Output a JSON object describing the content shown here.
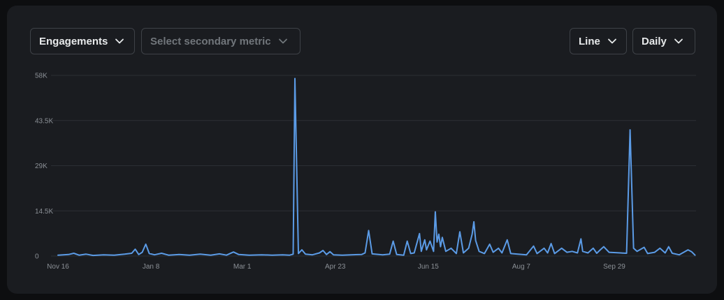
{
  "controls": {
    "primary_metric": "Engagements",
    "secondary_metric_placeholder": "Select secondary metric",
    "chart_type": "Line",
    "interval": "Daily"
  },
  "colors": {
    "line": "#5b9be6",
    "grid": "#2c2f34",
    "background": "#1a1c20"
  },
  "chart_data": {
    "type": "line",
    "title": "",
    "xlabel": "",
    "ylabel": "",
    "ylim": [
      0,
      58000
    ],
    "y_ticks": [
      {
        "value": 0,
        "label": "0"
      },
      {
        "value": 14500,
        "label": "14.5K"
      },
      {
        "value": 29000,
        "label": "29K"
      },
      {
        "value": 43500,
        "label": "43.5K"
      },
      {
        "value": 58000,
        "label": "58K"
      }
    ],
    "x_ticks": [
      {
        "date": "2022-11-16",
        "label": "Nov 16"
      },
      {
        "date": "2023-01-08",
        "label": "Jan 8"
      },
      {
        "date": "2023-03-01",
        "label": "Mar 1"
      },
      {
        "date": "2023-04-23",
        "label": "Apr 23"
      },
      {
        "date": "2023-06-15",
        "label": "Jun 15"
      },
      {
        "date": "2023-08-07",
        "label": "Aug 7"
      },
      {
        "date": "2023-09-29",
        "label": "Sep 29"
      }
    ],
    "grid": true,
    "legend": "none",
    "series": [
      {
        "points": [
          [
            "2022-11-16",
            300
          ],
          [
            "2022-11-22",
            500
          ],
          [
            "2022-11-25",
            900
          ],
          [
            "2022-11-28",
            300
          ],
          [
            "2022-12-02",
            600
          ],
          [
            "2022-12-06",
            200
          ],
          [
            "2022-12-12",
            400
          ],
          [
            "2022-12-18",
            300
          ],
          [
            "2022-12-24",
            600
          ],
          [
            "2022-12-28",
            900
          ],
          [
            "2022-12-30",
            2200
          ],
          [
            "2023-01-01",
            500
          ],
          [
            "2023-01-03",
            1200
          ],
          [
            "2023-01-05",
            3800
          ],
          [
            "2023-01-07",
            800
          ],
          [
            "2023-01-10",
            400
          ],
          [
            "2023-01-14",
            900
          ],
          [
            "2023-01-18",
            300
          ],
          [
            "2023-01-24",
            500
          ],
          [
            "2023-01-30",
            300
          ],
          [
            "2023-02-05",
            600
          ],
          [
            "2023-02-11",
            300
          ],
          [
            "2023-02-16",
            700
          ],
          [
            "2023-02-20",
            300
          ],
          [
            "2023-02-24",
            1300
          ],
          [
            "2023-02-27",
            500
          ],
          [
            "2023-03-05",
            300
          ],
          [
            "2023-03-12",
            400
          ],
          [
            "2023-03-18",
            300
          ],
          [
            "2023-03-24",
            400
          ],
          [
            "2023-03-28",
            300
          ],
          [
            "2023-03-30",
            600
          ],
          [
            "2023-03-31",
            57000
          ],
          [
            "2023-04-02",
            800
          ],
          [
            "2023-04-04",
            2000
          ],
          [
            "2023-04-06",
            600
          ],
          [
            "2023-04-10",
            400
          ],
          [
            "2023-04-14",
            1000
          ],
          [
            "2023-04-16",
            1800
          ],
          [
            "2023-04-18",
            500
          ],
          [
            "2023-04-20",
            1400
          ],
          [
            "2023-04-22",
            400
          ],
          [
            "2023-04-27",
            300
          ],
          [
            "2023-05-02",
            400
          ],
          [
            "2023-05-08",
            500
          ],
          [
            "2023-05-10",
            1000
          ],
          [
            "2023-05-12",
            8200
          ],
          [
            "2023-05-14",
            700
          ],
          [
            "2023-05-20",
            400
          ],
          [
            "2023-05-24",
            600
          ],
          [
            "2023-05-26",
            4800
          ],
          [
            "2023-05-28",
            500
          ],
          [
            "2023-06-01",
            300
          ],
          [
            "2023-06-03",
            4800
          ],
          [
            "2023-06-05",
            800
          ],
          [
            "2023-06-07",
            1000
          ],
          [
            "2023-06-10",
            7200
          ],
          [
            "2023-06-11",
            1500
          ],
          [
            "2023-06-13",
            5200
          ],
          [
            "2023-06-14",
            2000
          ],
          [
            "2023-06-16",
            4800
          ],
          [
            "2023-06-18",
            1500
          ],
          [
            "2023-06-19",
            14200
          ],
          [
            "2023-06-20",
            4500
          ],
          [
            "2023-06-21",
            7000
          ],
          [
            "2023-06-22",
            3000
          ],
          [
            "2023-06-23",
            6000
          ],
          [
            "2023-06-25",
            1500
          ],
          [
            "2023-06-28",
            2500
          ],
          [
            "2023-07-01",
            800
          ],
          [
            "2023-07-03",
            7800
          ],
          [
            "2023-07-05",
            1000
          ],
          [
            "2023-07-08",
            2500
          ],
          [
            "2023-07-10",
            7000
          ],
          [
            "2023-07-11",
            11000
          ],
          [
            "2023-07-12",
            5000
          ],
          [
            "2023-07-14",
            1500
          ],
          [
            "2023-07-17",
            800
          ],
          [
            "2023-07-20",
            3800
          ],
          [
            "2023-07-22",
            1200
          ],
          [
            "2023-07-25",
            2500
          ],
          [
            "2023-07-27",
            1000
          ],
          [
            "2023-07-30",
            5200
          ],
          [
            "2023-08-01",
            800
          ],
          [
            "2023-08-05",
            600
          ],
          [
            "2023-08-10",
            400
          ],
          [
            "2023-08-14",
            3200
          ],
          [
            "2023-08-16",
            800
          ],
          [
            "2023-08-20",
            2500
          ],
          [
            "2023-08-22",
            1000
          ],
          [
            "2023-08-24",
            4000
          ],
          [
            "2023-08-26",
            800
          ],
          [
            "2023-08-30",
            2500
          ],
          [
            "2023-09-02",
            1200
          ],
          [
            "2023-09-05",
            1500
          ],
          [
            "2023-09-08",
            1000
          ],
          [
            "2023-09-10",
            5500
          ],
          [
            "2023-09-11",
            1500
          ],
          [
            "2023-09-14",
            1000
          ],
          [
            "2023-09-17",
            2500
          ],
          [
            "2023-09-19",
            900
          ],
          [
            "2023-09-21",
            2000
          ],
          [
            "2023-09-23",
            3000
          ],
          [
            "2023-09-26",
            1200
          ],
          [
            "2023-10-06",
            900
          ],
          [
            "2023-10-08",
            40500
          ],
          [
            "2023-10-10",
            2500
          ],
          [
            "2023-10-12",
            1500
          ],
          [
            "2023-10-16",
            2800
          ],
          [
            "2023-10-18",
            800
          ],
          [
            "2023-10-22",
            1200
          ],
          [
            "2023-10-25",
            2500
          ],
          [
            "2023-10-28",
            1000
          ],
          [
            "2023-10-30",
            3000
          ],
          [
            "2023-11-01",
            900
          ],
          [
            "2023-11-05",
            400
          ],
          [
            "2023-11-10",
            2000
          ],
          [
            "2023-11-12",
            1400
          ],
          [
            "2023-11-14",
            300
          ]
        ]
      }
    ]
  }
}
